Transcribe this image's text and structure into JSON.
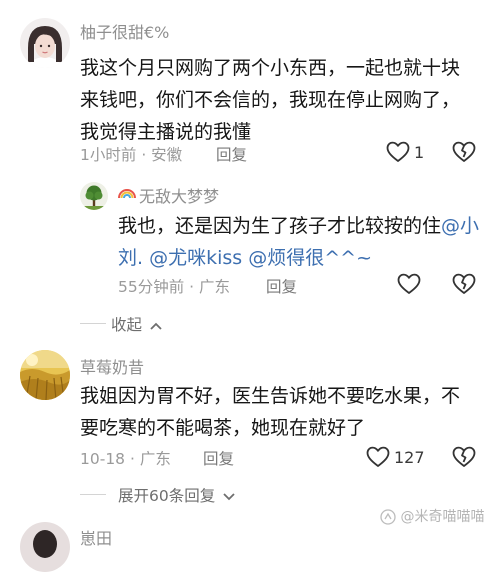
{
  "comments": [
    {
      "username": "柚子很甜€%",
      "text": "我这个月只网购了两个小东西，一起也就十块来钱吧，你们不会信的，我现在停止网购了，我觉得主播说的我懂",
      "time": "1小时前",
      "location": "安徽",
      "reply_label": "回复",
      "like_count": "1"
    },
    {
      "username": "无敌大梦梦",
      "text_prefix": "我也，还是因为生了孩子才比较按的住",
      "mentions": [
        "@小刘.",
        "@尤咪kiss",
        "@烦得很^^~"
      ],
      "time": "55分钟前",
      "location": "广东",
      "reply_label": "回复",
      "like_count": ""
    },
    {
      "username": "草莓奶昔",
      "text": "我姐因为胃不好，医生告诉她不要吃水果，不要吃寒的不能喝茶，她现在就好了",
      "time": "10-18",
      "location": "广东",
      "reply_label": "回复",
      "like_count": "127"
    },
    {
      "username": "崽田"
    }
  ],
  "collapse_label": "收起",
  "expand_label": "展开60条回复",
  "watermark": "@米奇喵喵喵",
  "colors": {
    "username": "#8f8f8f",
    "mention": "#3d6fb0",
    "meta": "#9a9a9a"
  }
}
